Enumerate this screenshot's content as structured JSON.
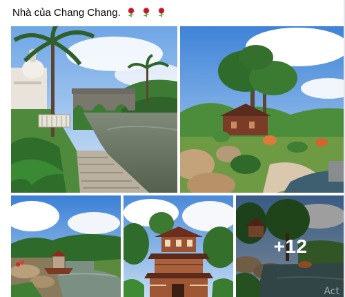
{
  "post": {
    "caption": "Nhà của Chang Chang.",
    "emoji": [
      "rose-emoji",
      "rose-emoji",
      "rose-emoji"
    ]
  },
  "gallery": {
    "photos": [
      {
        "name": "photo-river-bridge"
      },
      {
        "name": "photo-garden-cabin"
      },
      {
        "name": "photo-stream-boat"
      },
      {
        "name": "photo-wooden-tower"
      },
      {
        "name": "photo-pond-trees"
      }
    ],
    "more_label": "+12"
  },
  "overlay": {
    "watermark": "Act"
  },
  "colors": {
    "text": "#050505",
    "rose": "#d0222f",
    "overlay": "rgba(0,0,0,0.38)"
  }
}
